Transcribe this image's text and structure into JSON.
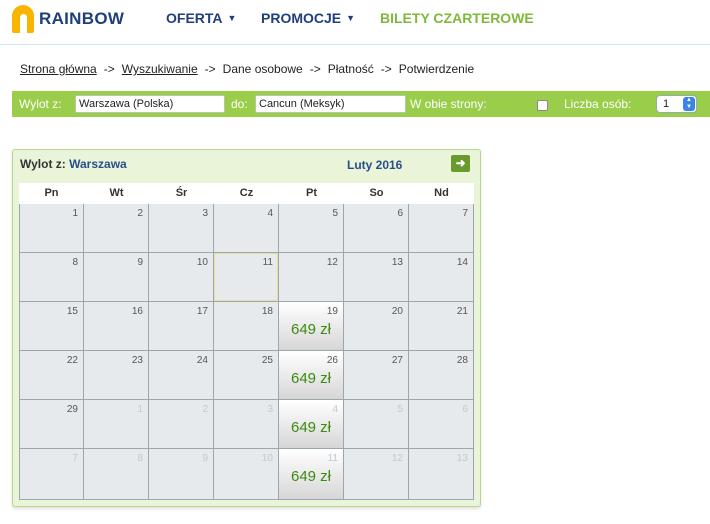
{
  "brand": {
    "name": "RAINBOW"
  },
  "nav": {
    "items": [
      {
        "label": "OFERTA",
        "has_caret": true
      },
      {
        "label": "PROMOCJE",
        "has_caret": true
      },
      {
        "label": "BILETY CZARTEROWE",
        "has_caret": false
      }
    ],
    "caret": "▼"
  },
  "breadcrumb": {
    "sep": "->",
    "items": [
      "Strona główna",
      "Wyszukiwanie",
      "Dane osobowe",
      "Płatność",
      "Potwierdzenie"
    ]
  },
  "search": {
    "from_label": "Wylot z:",
    "from_value": "Warszawa (Polska)",
    "to_label": "do:",
    "to_value": "Cancun (Meksyk)",
    "both_label": "W obie strony:",
    "persons_label": "Liczba osób:",
    "persons_value": "1"
  },
  "calendar": {
    "title_prefix": "Wylot z:",
    "title_city": "Warszawa",
    "month": "Luty 2016",
    "next_icon": "arrow-right-icon",
    "days": [
      "Pn",
      "Wt",
      "Śr",
      "Cz",
      "Pt",
      "So",
      "Nd"
    ],
    "weeks": [
      [
        {
          "d": "1"
        },
        {
          "d": "2"
        },
        {
          "d": "3"
        },
        {
          "d": "4"
        },
        {
          "d": "5"
        },
        {
          "d": "6"
        },
        {
          "d": "7"
        }
      ],
      [
        {
          "d": "8"
        },
        {
          "d": "9"
        },
        {
          "d": "10"
        },
        {
          "d": "11"
        },
        {
          "d": "12"
        },
        {
          "d": "13"
        },
        {
          "d": "14"
        }
      ],
      [
        {
          "d": "15"
        },
        {
          "d": "16"
        },
        {
          "d": "17"
        },
        {
          "d": "18"
        },
        {
          "d": "19",
          "price": "649 zł"
        },
        {
          "d": "20"
        },
        {
          "d": "21"
        }
      ],
      [
        {
          "d": "22"
        },
        {
          "d": "23"
        },
        {
          "d": "24"
        },
        {
          "d": "25"
        },
        {
          "d": "26",
          "price": "649 zł"
        },
        {
          "d": "27"
        },
        {
          "d": "28"
        }
      ],
      [
        {
          "d": "29"
        },
        {
          "d": "1",
          "other": true
        },
        {
          "d": "2",
          "other": true
        },
        {
          "d": "3",
          "other": true
        },
        {
          "d": "4",
          "other": true,
          "price": "649 zł"
        },
        {
          "d": "5",
          "other": true
        },
        {
          "d": "6",
          "other": true
        }
      ],
      [
        {
          "d": "7",
          "other": true
        },
        {
          "d": "8",
          "other": true
        },
        {
          "d": "9",
          "other": true
        },
        {
          "d": "10",
          "other": true
        },
        {
          "d": "11",
          "other": true,
          "price": "649 zł"
        },
        {
          "d": "12",
          "other": true
        },
        {
          "d": "13",
          "other": true
        }
      ]
    ]
  },
  "colors": {
    "brand_blue": "#1f3f7a",
    "brand_green": "#9acd4a",
    "price_green": "#3c8a12",
    "logo_yellow": "#f7b500"
  }
}
